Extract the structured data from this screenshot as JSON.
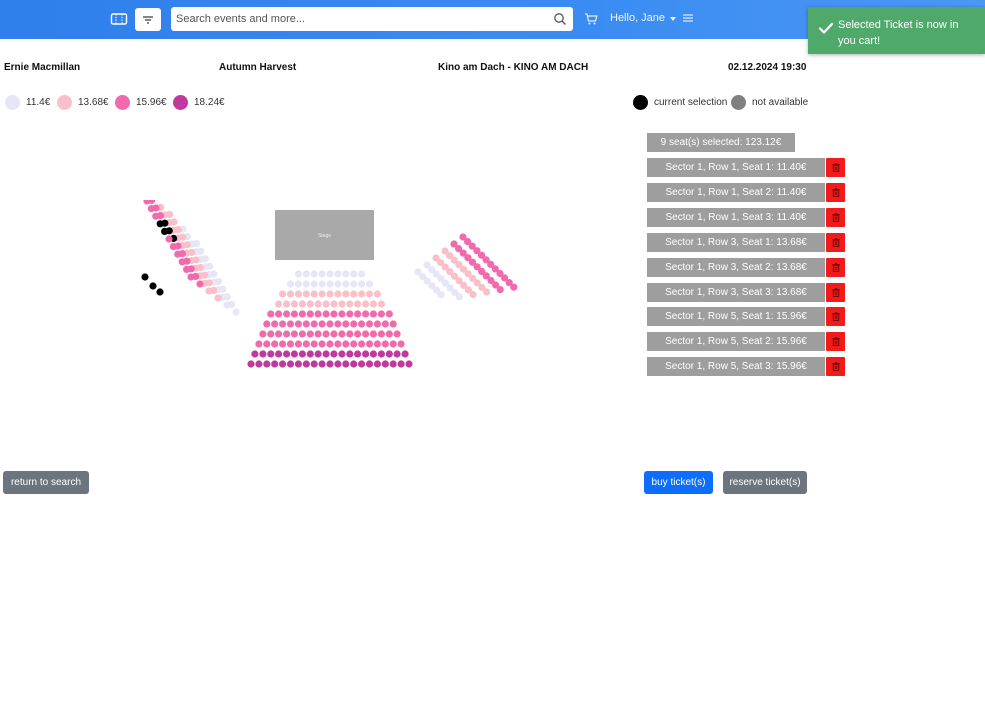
{
  "nav": {
    "search_placeholder": "Search events and more...",
    "greeting": "Hello, Jane"
  },
  "toast": {
    "message": "Selected Ticket is now in you cart!",
    "color": "#4fa96a"
  },
  "event": {
    "artist": "Ernie Macmillan",
    "title": "Autumn Harvest",
    "location": "Kino am Dach - KINO AM DACH",
    "datetime": "02.12.2024 19:30"
  },
  "legend": {
    "prices": [
      {
        "label": "11.4€",
        "color": "#e6e6f7"
      },
      {
        "label": "13.68€",
        "color": "#f9c0ca"
      },
      {
        "label": "15.96€",
        "color": "#f06aad"
      },
      {
        "label": "18.24€",
        "color": "#c03a9e"
      }
    ],
    "current_selection": {
      "label": "current selection",
      "color": "#000000"
    },
    "not_available": {
      "label": "not available",
      "color": "#808080"
    }
  },
  "stage": {
    "label": "Stage"
  },
  "cart": {
    "summary": "9 seat(s) selected: 123.12€",
    "tickets": [
      "Sector 1, Row 1, Seat 1: 11.40€",
      "Sector 1, Row 1, Seat 2: 11.40€",
      "Sector 1, Row 1, Seat 3: 11.40€",
      "Sector 1, Row 3, Seat 1: 13.68€",
      "Sector 1, Row 3, Seat 2: 13.68€",
      "Sector 1, Row 3, Seat 3: 13.68€",
      "Sector 1, Row 5, Seat 1: 15.96€",
      "Sector 1, Row 5, Seat 2: 15.96€",
      "Sector 1, Row 5, Seat 3: 15.96€"
    ]
  },
  "actions": {
    "return_label": "return to search",
    "buy_label": "buy ticket(s)",
    "reserve_label": "reserve ticket(s)"
  }
}
